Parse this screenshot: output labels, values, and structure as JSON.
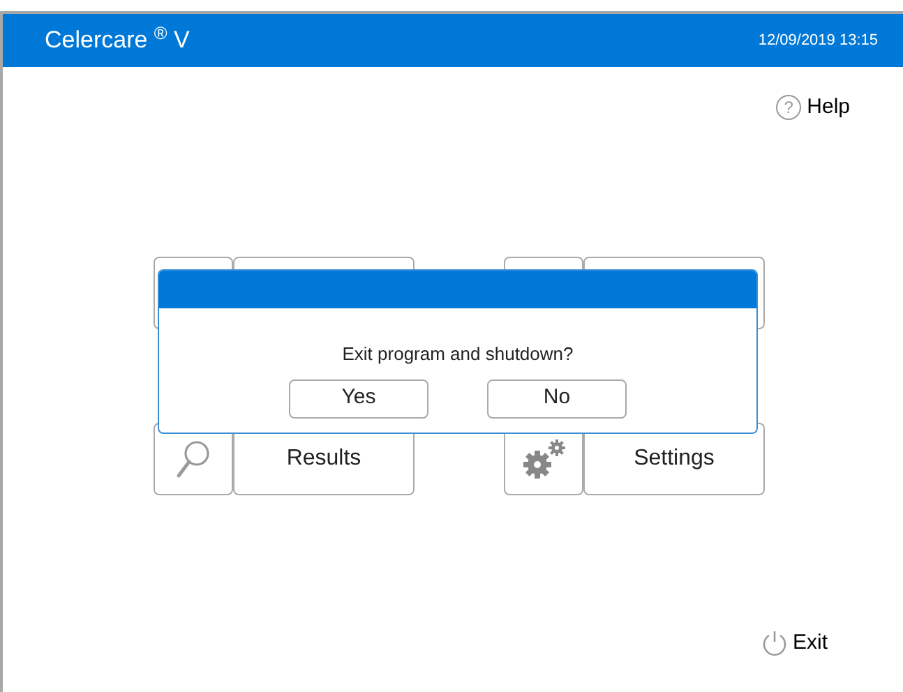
{
  "header": {
    "title": "Celercare",
    "title_mark": "®",
    "title_suffix": "V",
    "datetime": "12/09/2019 13:15"
  },
  "help": {
    "icon": "?",
    "label": "Help"
  },
  "tiles": [
    {
      "kind": "search",
      "label": "Results"
    },
    {
      "kind": "gears",
      "label": "Settings"
    }
  ],
  "dialog": {
    "message": "Exit program and shutdown?",
    "buttons": [
      "Yes",
      "No"
    ]
  },
  "exit": {
    "label": "Exit"
  }
}
